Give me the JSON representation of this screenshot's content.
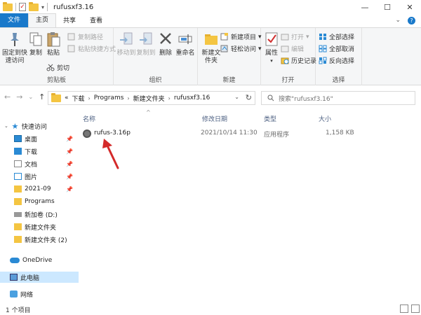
{
  "window": {
    "title": "rufusxf3.16",
    "minimize": "—",
    "maximize": "☐",
    "close": "✕"
  },
  "tabs": [
    "文件",
    "主页",
    "共享",
    "查看"
  ],
  "ribbon": {
    "clipboard": {
      "label": "剪贴板",
      "pin_quick": "固定到快速访问",
      "copy": "复制",
      "paste": "粘贴",
      "copy_path": "复制路径",
      "paste_shortcut": "粘贴快捷方式",
      "cut": "剪切"
    },
    "organize": {
      "label": "组织",
      "move_to": "移动到",
      "copy_to": "复制到",
      "delete": "删除",
      "rename": "重命名"
    },
    "new": {
      "label": "新建",
      "new_folder": "新建文件夹",
      "new_item": "新建项目",
      "easy_access": "轻松访问"
    },
    "open": {
      "label": "打开",
      "properties": "属性",
      "open": "打开",
      "edit": "编辑",
      "history": "历史记录"
    },
    "select": {
      "label": "选择",
      "select_all": "全部选择",
      "select_none": "全部取消",
      "invert": "反向选择"
    }
  },
  "address": {
    "prefix": "«",
    "crumbs": [
      "下载",
      "Programs",
      "新建文件夹",
      "rufusxf3.16"
    ],
    "search_placeholder": "搜索\"rufusxf3.16\""
  },
  "nav_pane": {
    "quick_access": "快速访问",
    "items": [
      {
        "label": "桌面",
        "pinned": true
      },
      {
        "label": "下载",
        "pinned": true
      },
      {
        "label": "文档",
        "pinned": true
      },
      {
        "label": "图片",
        "pinned": true
      },
      {
        "label": "2021-09",
        "pinned": true
      },
      {
        "label": "Programs",
        "pinned": false
      },
      {
        "label": "新加卷 (D:)",
        "pinned": false
      },
      {
        "label": "新建文件夹",
        "pinned": false
      },
      {
        "label": "新建文件夹 (2)",
        "pinned": false
      }
    ],
    "onedrive": "OneDrive",
    "this_pc": "此电脑",
    "network": "网络"
  },
  "columns": {
    "name": "名称",
    "modified": "修改日期",
    "type": "类型",
    "size": "大小"
  },
  "files": [
    {
      "name": "rufus-3.16p",
      "modified": "2021/10/14 11:30",
      "type": "应用程序",
      "size": "1,158 KB"
    }
  ],
  "status": {
    "count": "1 个项目"
  },
  "colors": {
    "accent": "#1979ca",
    "selection": "#cce8ff",
    "arrow": "#d42a2a"
  }
}
